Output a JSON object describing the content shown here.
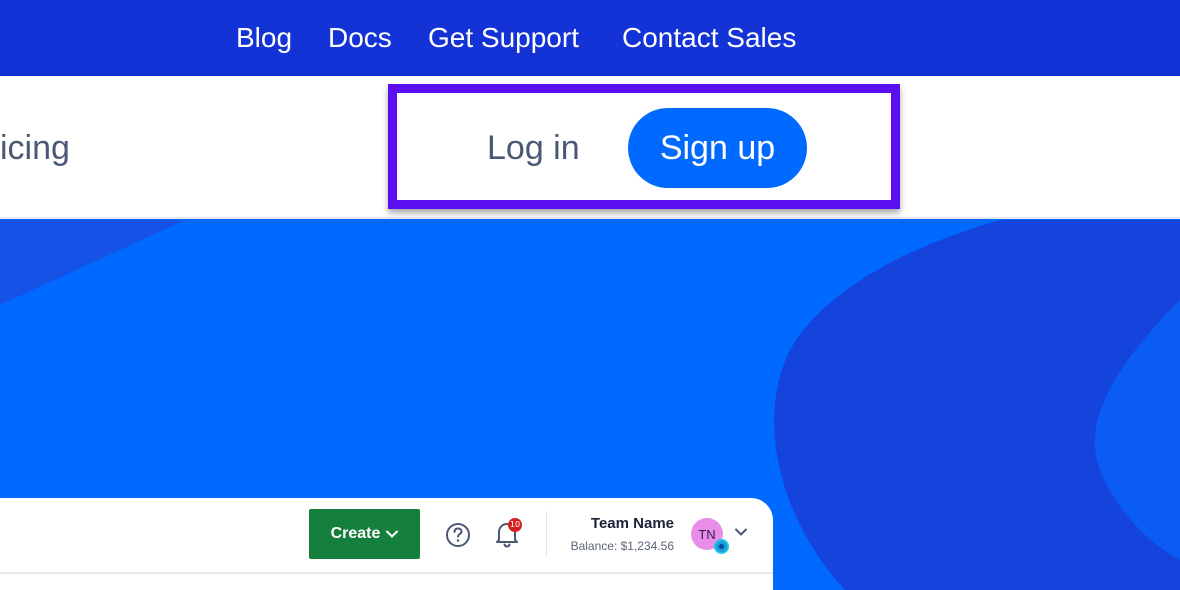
{
  "topbar": {
    "links": [
      "Blog",
      "Docs",
      "Get Support",
      "Contact Sales"
    ]
  },
  "mainnav": {
    "partial_item": "icing",
    "login_label": "Log in",
    "signup_label": "Sign up"
  },
  "panel": {
    "create_label": "Create",
    "notification_count": "10",
    "team_name": "Team Name",
    "balance": "Balance: $1,234.56",
    "avatar_initials": "TN"
  },
  "colors": {
    "topbar_bg": "#1433d6",
    "brand_blue": "#0069ff",
    "highlight_purple": "#5b0ff0",
    "create_green": "#15803d",
    "badge_red": "#d61f1f"
  },
  "icons": [
    "help-icon",
    "bell-icon",
    "chevron-down-icon",
    "caret-down-icon"
  ]
}
